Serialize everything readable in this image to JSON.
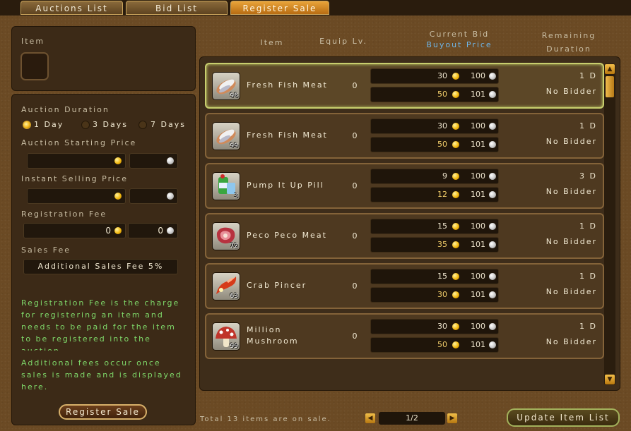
{
  "tabs": [
    "Auctions List",
    "Bid List",
    "Register Sale"
  ],
  "left": {
    "item_label": "Item",
    "duration_label": "Auction Duration",
    "durations": [
      "1 Day",
      "3 Days",
      "7 Days"
    ],
    "starting_price_label": "Auction Starting Price",
    "instant_label": "Instant Selling Price",
    "reg_fee_label": "Registration Fee",
    "reg_fee_gold": "0",
    "reg_fee_silver": "0",
    "sales_fee_label": "Sales Fee",
    "sales_fee_value": "Additional Sales Fee 5%",
    "info1": "Registration Fee is the charge for registering an item and needs to be paid for the item to be registered into the auction.",
    "info2": "Additional fees occur once sales is made and is displayed here.",
    "register_button": "Register Sale"
  },
  "headers": {
    "item": "Item",
    "equip": "Equip Lv.",
    "bid_line1": "Current Bid",
    "bid_line2": "Buyout Price",
    "rem_line1": "Remaining",
    "rem_line2": "Duration"
  },
  "rows": [
    {
      "name": "Fresh Fish Meat",
      "qty": "98",
      "equip": "0",
      "bid_gold": "30",
      "bid_silver": "100",
      "buy_gold": "50",
      "buy_silver": "101",
      "remaining": "1 D",
      "bidder": "No Bidder",
      "icon": "fish-meat-icon"
    },
    {
      "name": "Fresh Fish Meat",
      "qty": "99",
      "equip": "0",
      "bid_gold": "30",
      "bid_silver": "100",
      "buy_gold": "50",
      "buy_silver": "101",
      "remaining": "1 D",
      "bidder": "No Bidder",
      "icon": "fish-meat-icon"
    },
    {
      "name": "Pump It Up Pill",
      "qty": "3",
      "equip": "0",
      "bid_gold": "9",
      "bid_silver": "100",
      "buy_gold": "12",
      "buy_silver": "101",
      "remaining": "3 D",
      "bidder": "No Bidder",
      "icon": "pill-bottle-icon"
    },
    {
      "name": "Peco Peco Meat",
      "qty": "72",
      "equip": "0",
      "bid_gold": "15",
      "bid_silver": "100",
      "buy_gold": "35",
      "buy_silver": "101",
      "remaining": "1 D",
      "bidder": "No Bidder",
      "icon": "meat-icon"
    },
    {
      "name": "Crab Pincer",
      "qty": "63",
      "equip": "0",
      "bid_gold": "15",
      "bid_silver": "100",
      "buy_gold": "30",
      "buy_silver": "101",
      "remaining": "1 D",
      "bidder": "No Bidder",
      "icon": "crab-pincer-icon"
    },
    {
      "name": "Million Mushroom",
      "qty": "99",
      "equip": "0",
      "bid_gold": "30",
      "bid_silver": "100",
      "buy_gold": "50",
      "buy_silver": "101",
      "remaining": "1 D",
      "bidder": "No Bidder",
      "icon": "mushroom-icon"
    }
  ],
  "footer": {
    "total": "Total 13 items are on sale.",
    "page": "1/2",
    "update_button": "Update Item List"
  }
}
